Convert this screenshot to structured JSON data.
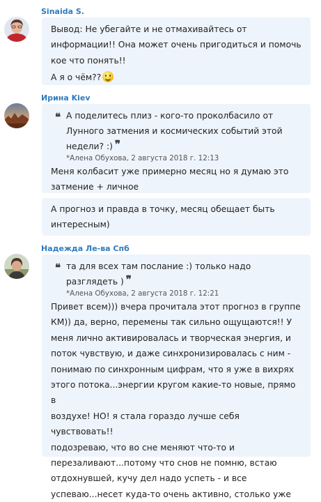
{
  "messages": [
    {
      "author": "Sinaida S.",
      "avatar_icon": "user-avatar-woman-red-blouse",
      "lines": [
        "Вывод: Не убегайте и не отмахивайтесь от",
        "информации!! Она может очень пригодиться и помочь",
        "кое что понять!!"
      ],
      "line2": "А я о чём??",
      "emoji": "smiley-icon"
    },
    {
      "author": "Ирина Kiev",
      "avatar_icon": "user-avatar-desert-landscape",
      "quote_lines": [
        "А поделитесь плиз - кого-то проколбасило от",
        "Лунного затмения и космических событий этой",
        "недели? :)"
      ],
      "quote_source": "*Алена Обухова, 2 августа 2018 г. 12:13",
      "reply_lines": [
        "Меня колбасит уже примерно месяц но я думаю это",
        "затмение + личное"
      ],
      "followup_lines": [
        "А прогноз и правда в точку, месяц обещает быть",
        "интересным)"
      ]
    },
    {
      "author": "Надежда Ле-ва Спб",
      "avatar_icon": "user-avatar-woman-outdoors",
      "quote_lines": [
        "та для всех там послание :) только надо",
        "разглядеть )"
      ],
      "quote_source": "*Алена Обухова, 2 августа 2018 г. 12:21",
      "reply_lines": [
        "Привет всем))) вчера прочитала этот прогноз в группе",
        "КМ)) да, верно, перемены так сильно ощущаются!! У",
        "меня лично активировалась и творческая энергия, и",
        "поток чувствую, и даже синхронизировалась с ним -",
        "понимаю по синхронным цифрам, что я уже в вихрях",
        "этого потока...энергии кругом какие-то новые, прямо в",
        "воздухе! НО! я стала гораздо лучше себя чувствовать!!",
        "подозреваю, что во сне меняют что-то и",
        "перезаливают...потому что снов не помню, встаю",
        "отдохнувшей, кучу дел надо успеть - и все",
        "успеваю...несет куда-то очень активно, столько уже"
      ]
    }
  ]
}
